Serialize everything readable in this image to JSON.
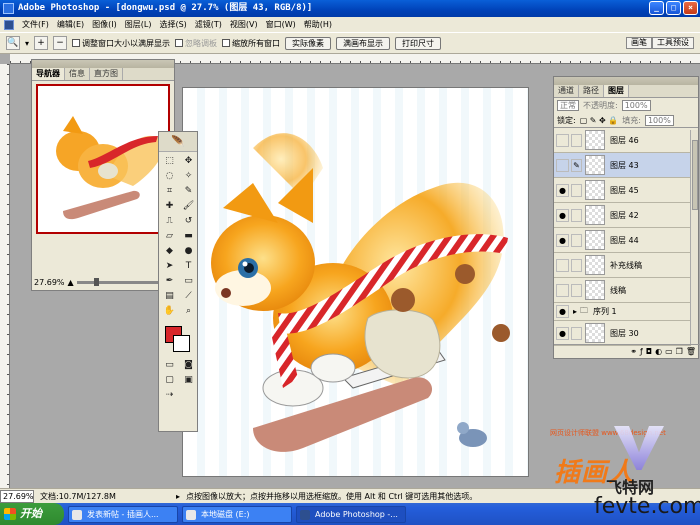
{
  "window": {
    "title": "Adobe Photoshop - [dongwu.psd @ 27.7% (图层 43, RGB/8)]",
    "buttons": [
      "_",
      "□",
      "×"
    ]
  },
  "menu": [
    "文件(F)",
    "编辑(E)",
    "图像(I)",
    "图层(L)",
    "选择(S)",
    "滤镜(T)",
    "视图(V)",
    "窗口(W)",
    "帮助(H)"
  ],
  "options": {
    "resize_windows": "调整窗口大小以满屏显示",
    "ignore_palettes": "忽略调板",
    "zoom_all": "缩放所有窗口",
    "actual_pixels": "实际像素",
    "fit_screen": "满画布显示",
    "print_size": "打印尺寸",
    "right_tabs": [
      "画笔",
      "工具预设"
    ]
  },
  "navigator": {
    "tabs": [
      "导航器",
      "信息",
      "直方图"
    ],
    "zoom": "27.69%"
  },
  "layers_panel": {
    "tabs": [
      "通道",
      "路径",
      "图层"
    ],
    "blend_mode": "正常",
    "opacity_label": "不透明度:",
    "opacity": "100%",
    "lock_label": "锁定:",
    "fill_label": "填充:",
    "fill": "100%",
    "layers": [
      {
        "name": "图层 46",
        "visible": false,
        "selected": false
      },
      {
        "name": "图层 43",
        "visible": false,
        "selected": true
      },
      {
        "name": "图层 45",
        "visible": true,
        "selected": false
      },
      {
        "name": "图层 42",
        "visible": true,
        "selected": false
      },
      {
        "name": "图层 44",
        "visible": true,
        "selected": false
      },
      {
        "name": "补充线稿",
        "visible": false,
        "selected": false
      },
      {
        "name": "线稿",
        "visible": false,
        "selected": false
      },
      {
        "name": "序列 1",
        "visible": true,
        "selected": false
      },
      {
        "name": "图层 30",
        "visible": true,
        "selected": false
      }
    ]
  },
  "colors": {
    "foreground": "#d8262a",
    "background": "#ffffff"
  },
  "status": {
    "zoom": "27.69%",
    "doc": "文档:10.7M/127.8M",
    "hint": "点按图像以放大；点按并拖移以用选框缩放。使用 Alt 和 Ctrl 键可选用其他选项。"
  },
  "taskbar": {
    "start": "开始",
    "items": [
      "发表新帖 - 插画人...",
      "本地磁盘 (E:)",
      "Adobe Photoshop -..."
    ]
  },
  "watermark": {
    "line1": "网页设计师联盟 www.68design.net",
    "brand": "插画人",
    "site": "飞特网",
    "url": "fevte.com"
  }
}
